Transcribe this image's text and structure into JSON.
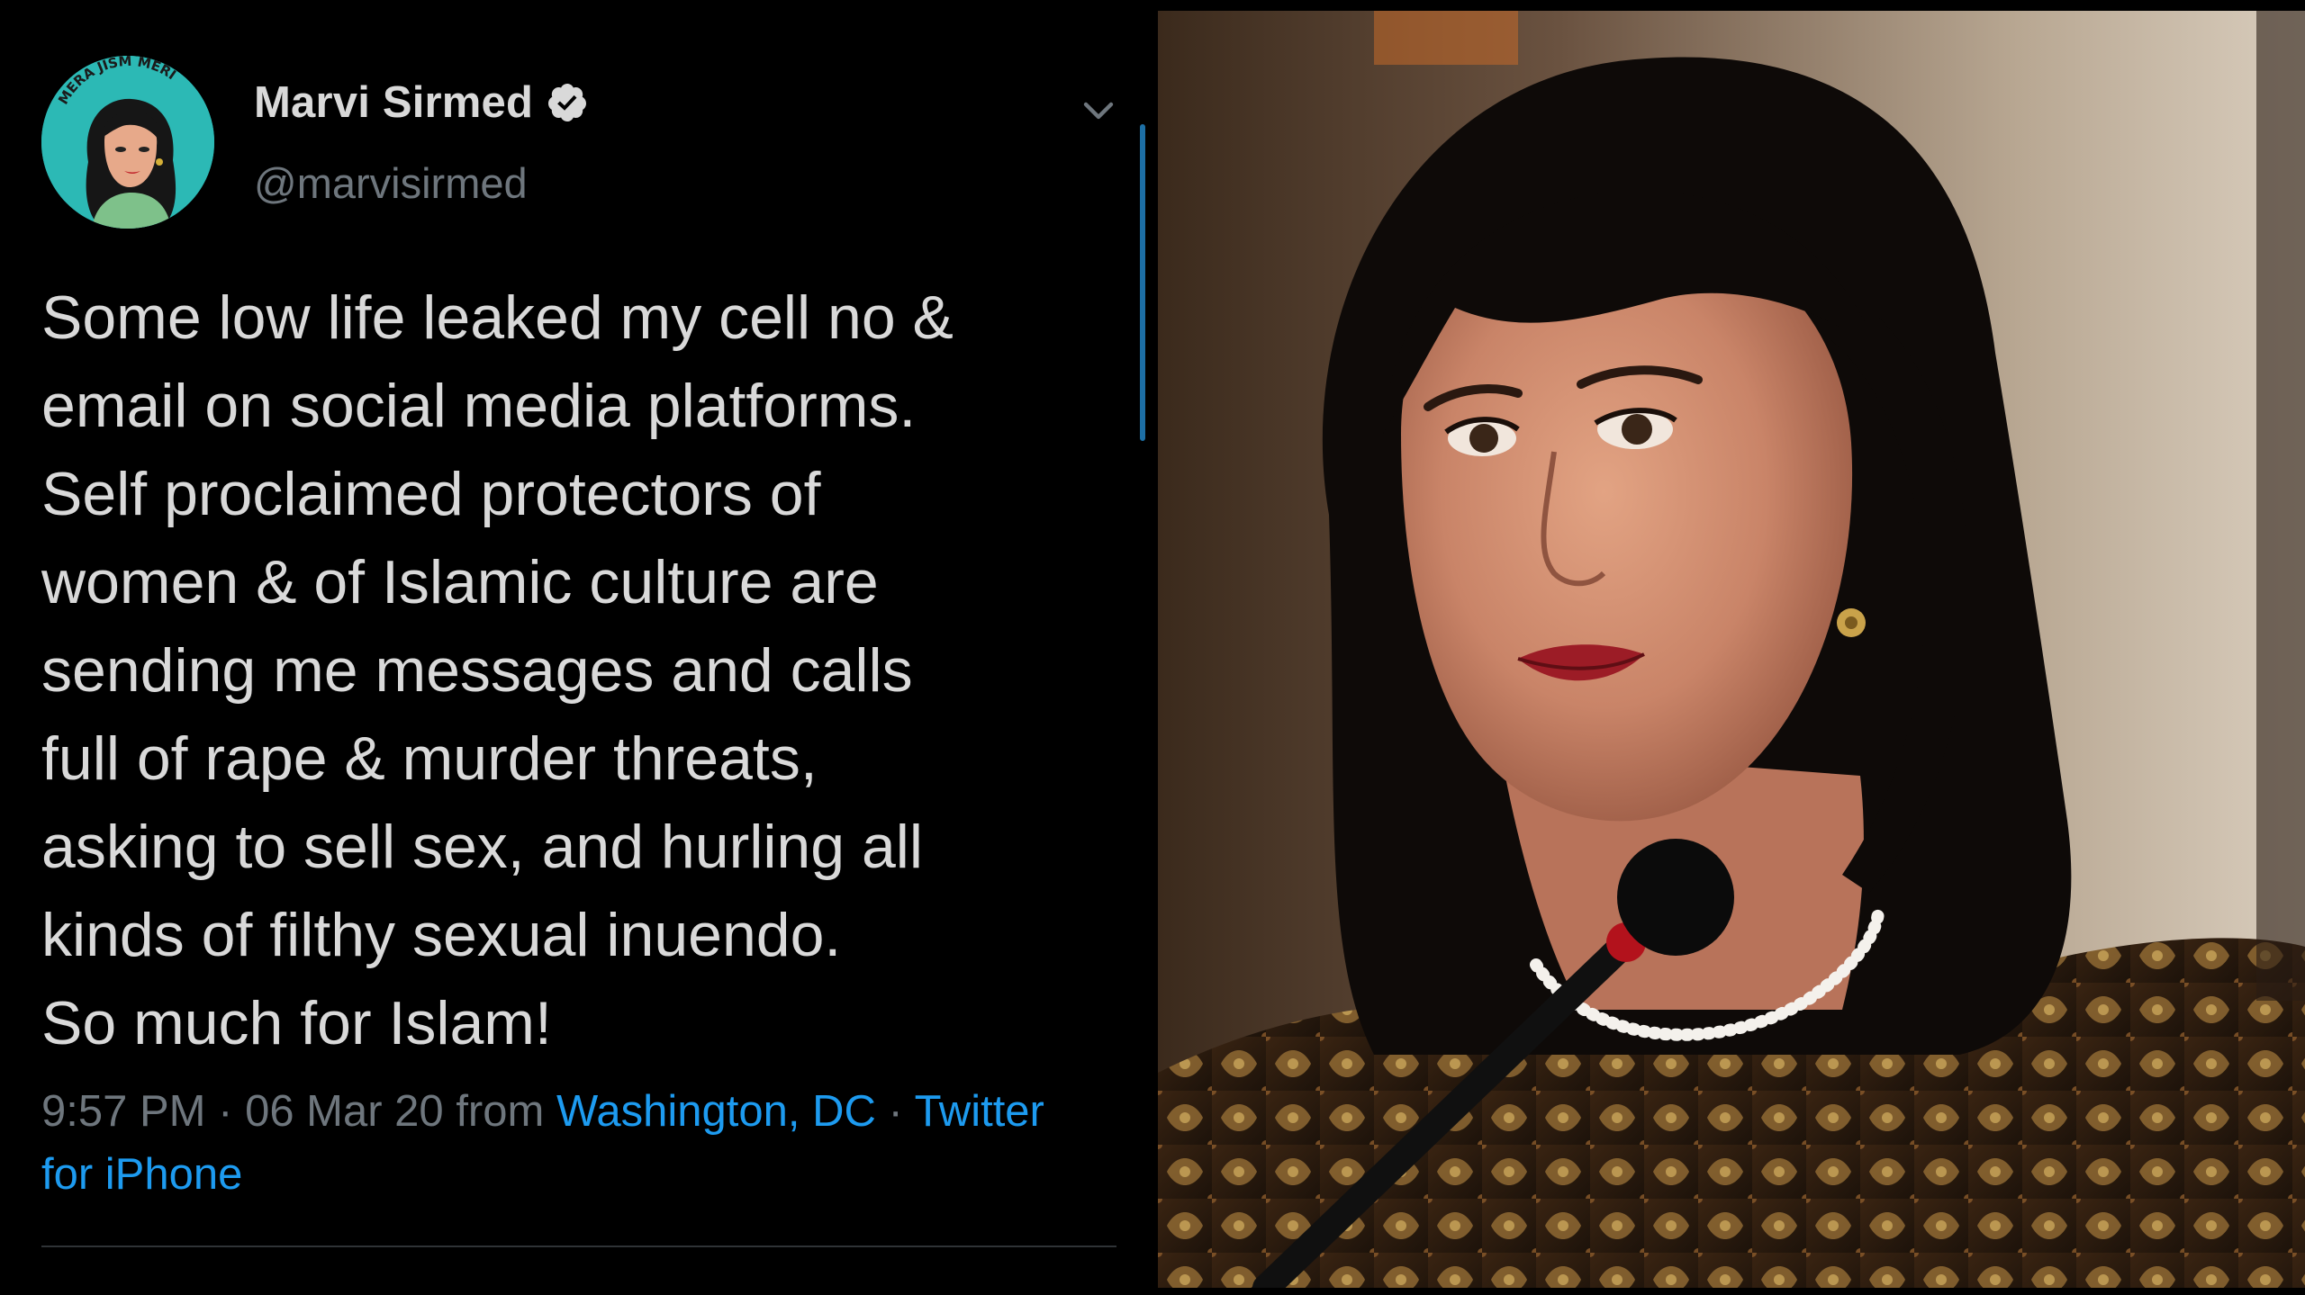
{
  "tweet": {
    "display_name": "Marvi Sirmed",
    "handle": "@marvisirmed",
    "avatar_banner_text": "MERA JISM MERI",
    "text": "Some low life leaked my cell no &\nemail on social media platforms.\nSelf proclaimed protectors of\nwomen & of Islamic culture are\nsending me messages and calls\nfull of rape & murder threats,\nasking to sell sex, and hurling all\nkinds of filthy sexual inuendo.\nSo much for Islam!",
    "time": "9:57 PM",
    "separator": "·",
    "date": "06 Mar 20",
    "from_label": "from",
    "location": "Washington, DC",
    "source_part1": "Twitter",
    "source_part2": "for iPhone"
  },
  "colors": {
    "background": "#000000",
    "text": "#d9d9d9",
    "muted": "#6e767d",
    "link": "#1d9bf0",
    "verified_badge": "#d9d9d9",
    "avatar_bg": "#2cb9b5"
  },
  "icons": {
    "verified": "verified-badge-icon",
    "more": "chevron-down-icon"
  }
}
